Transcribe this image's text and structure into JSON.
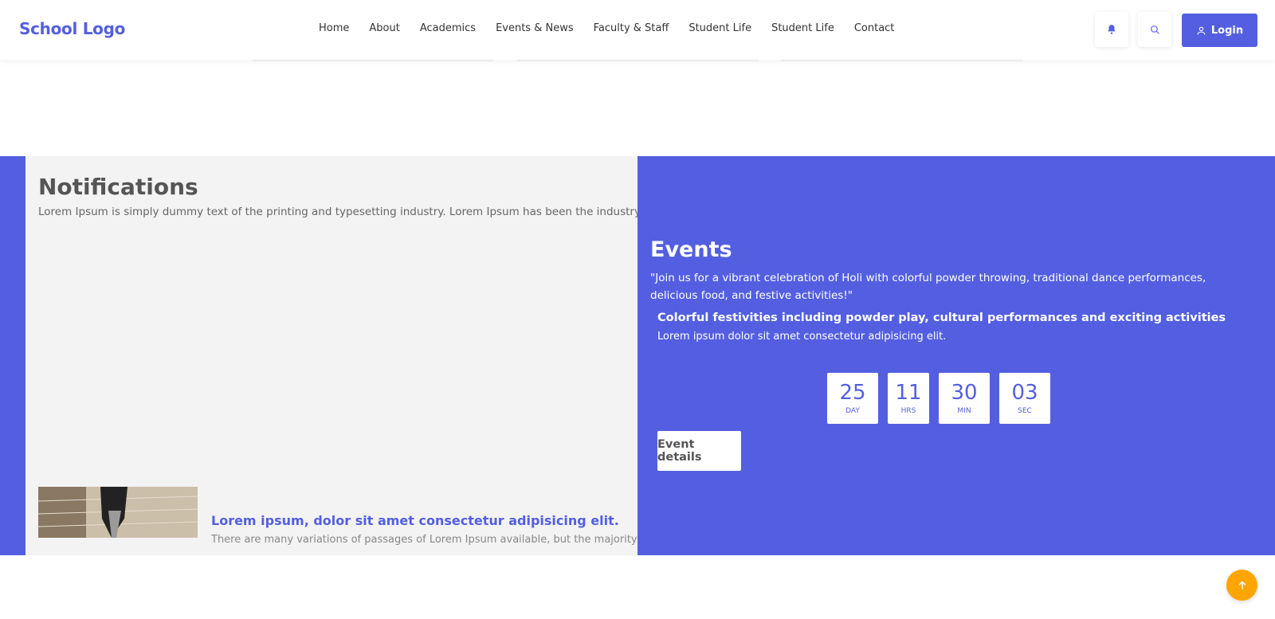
{
  "header": {
    "logo": "School Logo",
    "nav": [
      "Home",
      "About",
      "Academics",
      "Events & News",
      "Faculty & Staff",
      "Student Life",
      "Student Life",
      "Contact"
    ],
    "login_label": "Login",
    "notification_icon": "bell-icon",
    "search_icon": "search-icon"
  },
  "notifications": {
    "title": "Notifications",
    "description": "Lorem Ipsum is simply dummy text of the printing and typesetting industry. Lorem Ipsum has been the industry's standard.",
    "item": {
      "title": "Lorem ipsum, dolor sit amet consectetur adipisicing elit.",
      "text": "There are many variations of passages of Lorem Ipsum available, but the majority have"
    }
  },
  "events": {
    "title": "Events",
    "quote": "\"Join us for a vibrant celebration of Holi with colorful powder throwing, traditional dance performances, delicious food, and festive activities!\"",
    "subtitle": "Colorful festivities including powder play, cultural performances and exciting activities",
    "sub_description": "Lorem ipsum dolor sit amet consectetur adipisicing elit.",
    "countdown": [
      {
        "value": "25",
        "unit": "DAY"
      },
      {
        "value": "11",
        "unit": "HRS"
      },
      {
        "value": "30",
        "unit": "MIN"
      },
      {
        "value": "03",
        "unit": "SEC"
      }
    ],
    "details_button": "Event details"
  },
  "colors": {
    "primary": "#535fe0",
    "panel": "#f3f3f3",
    "scroll_top": "#ffa500"
  }
}
